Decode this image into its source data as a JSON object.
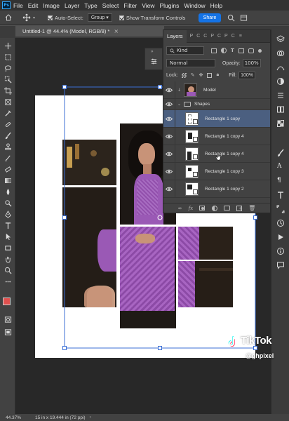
{
  "menu": {
    "logo": "Ps",
    "items": [
      "File",
      "Edit",
      "Image",
      "Layer",
      "Type",
      "Select",
      "Filter",
      "View",
      "Plugins",
      "Window",
      "Help"
    ]
  },
  "options": {
    "auto_select_label": "Auto-Select:",
    "auto_select_value": "Group",
    "transform_label": "Show Transform Controls",
    "share_label": "Share"
  },
  "document": {
    "tab_title": "Untitled-1 @ 44.4% (Model, RGB/8) *",
    "close": "×"
  },
  "layers": {
    "tabs": {
      "active": "Layers",
      "others": [
        "P",
        "C",
        "C",
        "P",
        "C",
        "P",
        "C"
      ]
    },
    "filter_kind": "Kind",
    "blend_mode": "Normal",
    "opacity_label": "Opacity:",
    "opacity_value": "100%",
    "lock_label": "Lock:",
    "fill_label": "Fill:",
    "fill_value": "100%",
    "rows": [
      {
        "name": "Model",
        "kind": "photo"
      },
      {
        "name": "Shapes",
        "kind": "group"
      },
      {
        "name": "Rectangle 1 copy",
        "kind": "shape",
        "selected": true
      },
      {
        "name": "Rectangle 1 copy 4",
        "kind": "shape"
      },
      {
        "name": "Rectangle 1 copy 4",
        "kind": "shape"
      },
      {
        "name": "Rectangle 1 copy 3",
        "kind": "shape"
      },
      {
        "name": "Rectangle 1 copy 2",
        "kind": "shape"
      }
    ]
  },
  "status": {
    "zoom": "44.37%",
    "doc_size": "15 in x 19.444 in (72 ppi)"
  },
  "watermark": {
    "brand": "TikTok",
    "user": "@ghpixel"
  },
  "colors": {
    "foreground": "#e0504e",
    "background": "#ffffff",
    "selection": "#4b5f80",
    "dress": "#9a59b5"
  }
}
